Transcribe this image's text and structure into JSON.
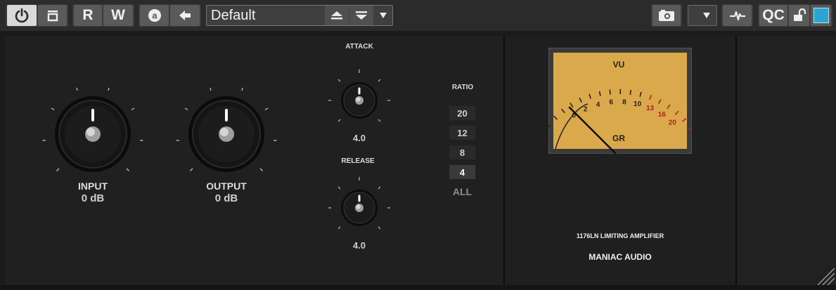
{
  "toolbar": {
    "read_label": "R",
    "write_label": "W",
    "preset_name": "Default",
    "qc_label": "QC",
    "icons": [
      "power-icon",
      "bypass-icon",
      "automation-a-icon",
      "back-arrow-icon",
      "preset-up-icon",
      "preset-down-icon",
      "menu-down-icon",
      "camera-icon",
      "dropdown-icon",
      "sidechain-wave-icon",
      "lock-open-icon"
    ],
    "active_color": "#2aa4d3"
  },
  "controls": {
    "input": {
      "label": "INPUT",
      "value": "0 dB"
    },
    "output": {
      "label": "OUTPUT",
      "value": "0 dB"
    },
    "attack": {
      "label": "ATTACK",
      "value": "4.0"
    },
    "release": {
      "label": "RELEASE",
      "value": "4.0"
    }
  },
  "ratio": {
    "label": "RATIO",
    "options": [
      "20",
      "12",
      "8",
      "4"
    ],
    "selected": "4",
    "all_label": "ALL"
  },
  "meter": {
    "title": "VU",
    "mode_label": "GR",
    "scale_labels": [
      "0",
      "2",
      "4",
      "6",
      "8",
      "10",
      "13",
      "16",
      "20"
    ],
    "face_color": "#d9a94b",
    "red_color": "#b3221a"
  },
  "brand": {
    "model": "1176LN LIMITING AMPLIFIER",
    "maker": "MANIAC AUDIO"
  }
}
